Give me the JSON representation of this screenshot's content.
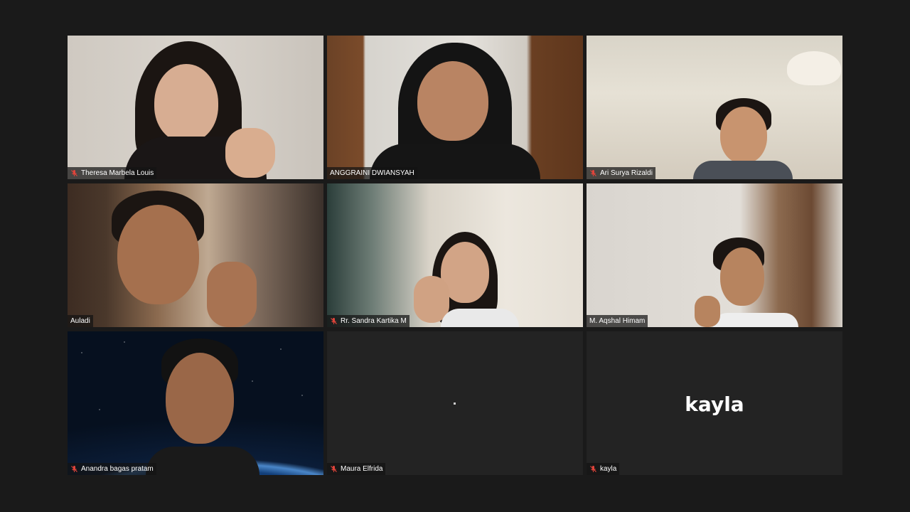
{
  "window": {
    "background": "#1a1a1a",
    "active_speaker_border": "#e8ec7a"
  },
  "participants": [
    {
      "name": "Theresa Marbela Louis",
      "muted": true,
      "video": true,
      "active": false
    },
    {
      "name": "ANGGRAINI DWIANSYAH",
      "muted": false,
      "video": true,
      "active": true
    },
    {
      "name": "Ari Surya Rizaldi",
      "muted": true,
      "video": true,
      "active": false
    },
    {
      "name": "Auladi",
      "muted": false,
      "video": true,
      "active": false
    },
    {
      "name": "Rr. Sandra Kartika M",
      "muted": true,
      "video": true,
      "active": false
    },
    {
      "name": "M. Aqshal Himam",
      "muted": false,
      "video": true,
      "active": false
    },
    {
      "name": "Anandra bagas pratam",
      "muted": true,
      "video": true,
      "active": false
    },
    {
      "name": "Maura Elfrida",
      "muted": true,
      "video": false,
      "active": false
    },
    {
      "name": "kayla",
      "muted": true,
      "video": false,
      "active": false,
      "center_label": "kayla"
    }
  ],
  "icons": {
    "mute": "microphone-muted-icon"
  },
  "colors": {
    "mute_icon": "#e0443b",
    "nameplate_text": "#ffffff"
  }
}
